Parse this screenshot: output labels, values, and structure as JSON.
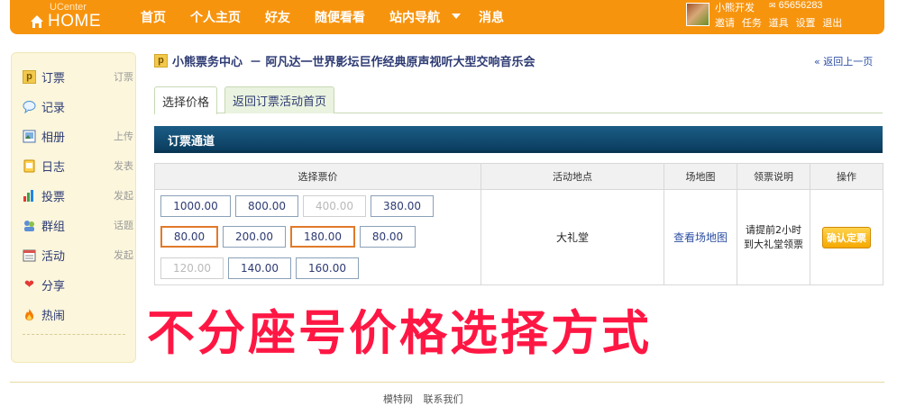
{
  "header": {
    "logo_small": "UCenter",
    "logo_big": "HOME",
    "nav": [
      "首页",
      "个人主页",
      "好友",
      "随便看看",
      "站内导航",
      "消息"
    ],
    "user": {
      "name": "小熊开发",
      "id": "65656283",
      "links": [
        "邀请",
        "任务",
        "道具",
        "设置",
        "退出"
      ]
    }
  },
  "sidebar": {
    "items": [
      {
        "label": "订票",
        "extra": "订票",
        "icon": "p-icon"
      },
      {
        "label": "记录",
        "extra": "",
        "icon": "chat-bubble-icon"
      },
      {
        "label": "相册",
        "extra": "上传",
        "icon": "photo-icon"
      },
      {
        "label": "日志",
        "extra": "发表",
        "icon": "diary-icon"
      },
      {
        "label": "投票",
        "extra": "发起",
        "icon": "bar-chart-icon"
      },
      {
        "label": "群组",
        "extra": "话题",
        "icon": "group-icon"
      },
      {
        "label": "活动",
        "extra": "发起",
        "icon": "calendar-icon"
      },
      {
        "label": "分享",
        "extra": "",
        "icon": "heart-icon"
      },
      {
        "label": "热闹",
        "extra": "",
        "icon": "fire-icon"
      }
    ]
  },
  "breadcrumb": {
    "icon": "p",
    "home": "小熊票务中心",
    "title": "－ 阿凡达一世界影坛巨作经典原声视听大型交响音乐会",
    "back": "« 返回上一页"
  },
  "tabs": [
    "选择价格",
    "返回订票活动首页"
  ],
  "section_title": "订票通道",
  "table": {
    "headers": [
      "选择票价",
      "活动地点",
      "场地图",
      "领票说明",
      "操作"
    ],
    "prices": [
      {
        "value": "1000.00",
        "state": "normal"
      },
      {
        "value": "800.00",
        "state": "normal"
      },
      {
        "value": "400.00",
        "state": "disabled"
      },
      {
        "value": "380.00",
        "state": "normal"
      },
      {
        "value": "80.00",
        "state": "selected"
      },
      {
        "value": "200.00",
        "state": "normal"
      },
      {
        "value": "180.00",
        "state": "selected"
      },
      {
        "value": "80.00",
        "state": "normal"
      },
      {
        "value": "120.00",
        "state": "disabled"
      },
      {
        "value": "140.00",
        "state": "normal"
      },
      {
        "value": "160.00",
        "state": "normal"
      }
    ],
    "location": "大礼堂",
    "map_link": "查看场地图",
    "note": "请提前2小时到大礼堂领票",
    "action": "确认定票"
  },
  "caption": "不分座号价格选择方式",
  "footer": {
    "links": [
      "模特网",
      "联系我们"
    ]
  },
  "colors": {
    "topbar": "#f7940e",
    "section_header": "#0b3d5f",
    "caption": "#ff1744",
    "selected_border": "#e07a2a"
  }
}
